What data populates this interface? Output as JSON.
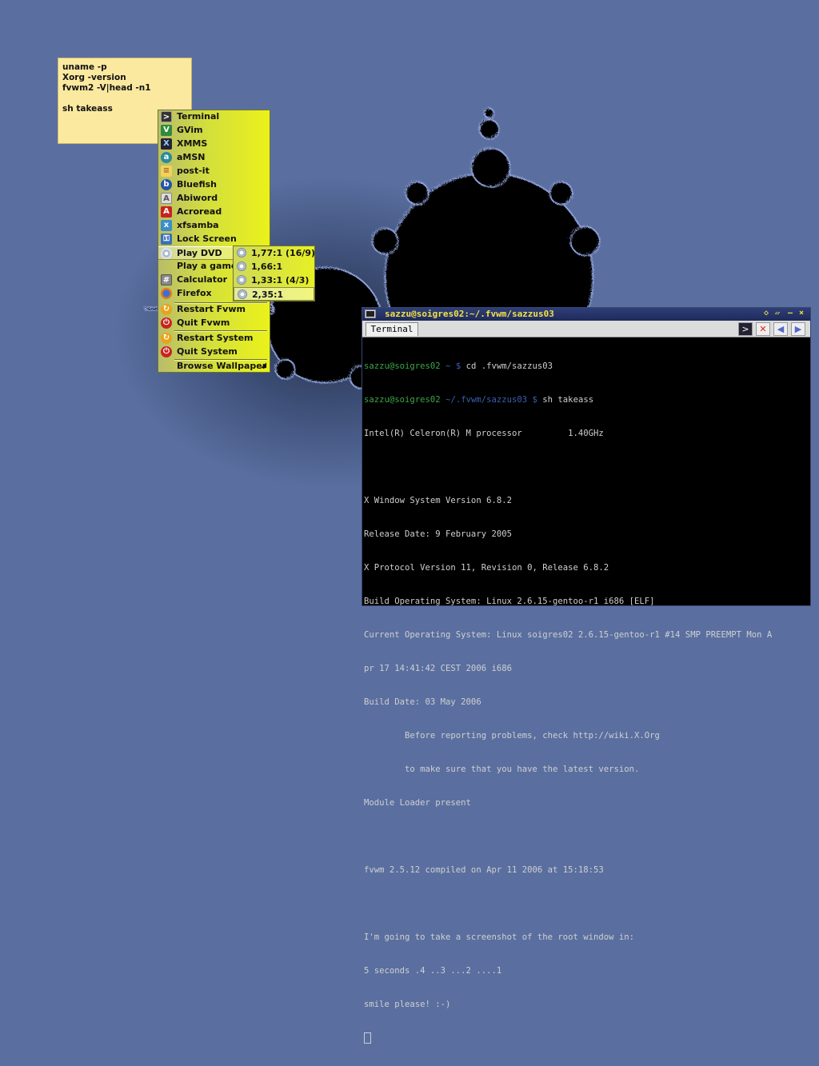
{
  "colors": {
    "desktop": "#5a6fa0",
    "menu_gradient_start": "#b9bd6a",
    "menu_gradient_end": "#eaf21a",
    "postit_bg": "#fbe9a0",
    "titlebar_text": "#f2e24a",
    "prompt_user": "#3da64a",
    "prompt_path": "#3b5fb0"
  },
  "postit": {
    "lines": [
      "uname -p",
      "Xorg -version",
      "fvwm2 -V|head -n1",
      "",
      "sh takeass"
    ]
  },
  "menu": {
    "items": [
      {
        "label": "Terminal",
        "icon": "terminal-icon"
      },
      {
        "label": "GVim",
        "icon": "gvim-icon"
      },
      {
        "label": "XMMS",
        "icon": "xmms-icon"
      },
      {
        "label": "aMSN",
        "icon": "amsn-icon"
      },
      {
        "label": "post-it",
        "icon": "post-it-icon"
      },
      {
        "label": "Bluefish",
        "icon": "bluefish-icon"
      },
      {
        "label": "Abiword",
        "icon": "abiword-icon"
      },
      {
        "label": "Acroread",
        "icon": "acroread-icon"
      },
      {
        "label": "xfsamba",
        "icon": "xfsamba-icon"
      },
      {
        "label": "Lock Screen",
        "icon": "lock-screen-icon"
      },
      {
        "label": "Play DVD",
        "icon": "dvd-icon"
      },
      {
        "label": "Play a game",
        "icon": ""
      },
      {
        "label": "Calculator",
        "icon": "calculator-icon"
      },
      {
        "label": "Firefox",
        "icon": "firefox-icon"
      },
      {
        "label": "Restart Fvwm",
        "icon": "restart-icon"
      },
      {
        "label": "Quit Fvwm",
        "icon": "power-icon"
      },
      {
        "label": "Restart System",
        "icon": "restart-icon"
      },
      {
        "label": "Quit System",
        "icon": "power-icon"
      },
      {
        "label": "Browse Wallpaper",
        "icon": ""
      }
    ],
    "dvd_submenu": [
      "1,77:1 (16/9)",
      "1,66:1",
      "1,33:1 (4/3)",
      "2,35:1"
    ]
  },
  "terminal": {
    "title": "sazzu@soigres02:~/.fvwm/sazzus03",
    "tab_label": "Terminal",
    "prompt1": {
      "user": "sazzu@soigres02",
      "path": "~",
      "sep": "$",
      "cmd": "cd .fvwm/sazzus03"
    },
    "prompt2": {
      "user": "sazzu@soigres02",
      "path": "~/.fvwm/sazzus03",
      "sep": "$",
      "cmd": "sh takeass"
    },
    "lines": [
      "Intel(R) Celeron(R) M processor         1.40GHz",
      "",
      "X Window System Version 6.8.2",
      "Release Date: 9 February 2005",
      "X Protocol Version 11, Revision 0, Release 6.8.2",
      "Build Operating System: Linux 2.6.15-gentoo-r1 i686 [ELF]",
      "Current Operating System: Linux soigres02 2.6.15-gentoo-r1 #14 SMP PREEMPT Mon A",
      "pr 17 14:41:42 CEST 2006 i686",
      "Build Date: 03 May 2006",
      "        Before reporting problems, check http://wiki.X.Org",
      "        to make sure that you have the latest version.",
      "Module Loader present",
      "",
      "fvwm 2.5.12 compiled on Apr 11 2006 at 15:18:53",
      "",
      "I'm going to take a screenshot of the root window in:",
      "5 seconds .4 ..3 ...2 ....1",
      "smile please! :-)"
    ]
  }
}
